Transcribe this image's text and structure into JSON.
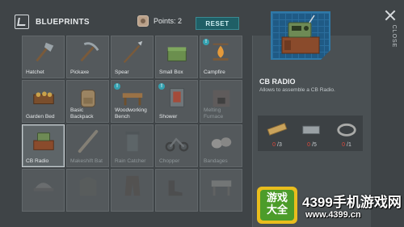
{
  "header": {
    "title": "BLUEPRINTS",
    "points_label": "Points:",
    "points_value": "2",
    "reset_label": "RESET"
  },
  "blueprints": [
    {
      "label": "Hatchet",
      "icon": "hatchet-icon",
      "new": false,
      "locked": false
    },
    {
      "label": "Pickaxe",
      "icon": "pickaxe-icon",
      "new": false,
      "locked": false
    },
    {
      "label": "Spear",
      "icon": "spear-icon",
      "new": false,
      "locked": false
    },
    {
      "label": "Small Box",
      "icon": "small-box-icon",
      "new": false,
      "locked": false
    },
    {
      "label": "Campfire",
      "icon": "campfire-icon",
      "new": true,
      "locked": false
    },
    {
      "label": "Garden Bed",
      "icon": "garden-bed-icon",
      "new": false,
      "locked": false
    },
    {
      "label": "Basic Backpack",
      "icon": "backpack-icon",
      "new": false,
      "locked": false
    },
    {
      "label": "Woodworking Bench",
      "icon": "woodworking-bench-icon",
      "new": true,
      "locked": false
    },
    {
      "label": "Shower",
      "icon": "shower-icon",
      "new": true,
      "locked": false
    },
    {
      "label": "Melting Furnace",
      "icon": "furnace-icon",
      "new": false,
      "locked": true
    },
    {
      "label": "CB Radio",
      "icon": "cb-radio-icon",
      "new": false,
      "locked": false,
      "selected": true
    },
    {
      "label": "Makeshift Bat",
      "icon": "bat-icon",
      "new": false,
      "locked": true
    },
    {
      "label": "Rain Catcher",
      "icon": "rain-catcher-icon",
      "new": false,
      "locked": true
    },
    {
      "label": "Chopper",
      "icon": "chopper-icon",
      "new": false,
      "locked": true
    },
    {
      "label": "Bandages",
      "icon": "bandages-icon",
      "new": false,
      "locked": true
    },
    {
      "label": "",
      "icon": "cap-icon",
      "new": false,
      "locked": true
    },
    {
      "label": "",
      "icon": "jacket-icon",
      "new": false,
      "locked": true
    },
    {
      "label": "",
      "icon": "pants-icon",
      "new": false,
      "locked": true
    },
    {
      "label": "",
      "icon": "boots-icon",
      "new": false,
      "locked": true
    },
    {
      "label": "",
      "icon": "workbench-icon",
      "new": false,
      "locked": true
    }
  ],
  "detail": {
    "name": "CB RADIO",
    "description": "Allows to assemble a CB Radio.",
    "materials": [
      {
        "icon": "wood-plank-icon",
        "have": "0",
        "need": "/3"
      },
      {
        "icon": "metal-bar-icon",
        "have": "0",
        "need": "/5"
      },
      {
        "icon": "wire-icon",
        "have": "0",
        "need": "/1"
      }
    ]
  },
  "close_label": "CLOSE",
  "watermark": {
    "logo_text": "游戏大全",
    "brand": "4399手机游戏网",
    "url": "www.4399.cn"
  },
  "colors": {
    "background": "#3f4447",
    "reset_button": "#1f5f66",
    "new_badge": "#35a1b0",
    "missing_count": "#e0483c"
  }
}
